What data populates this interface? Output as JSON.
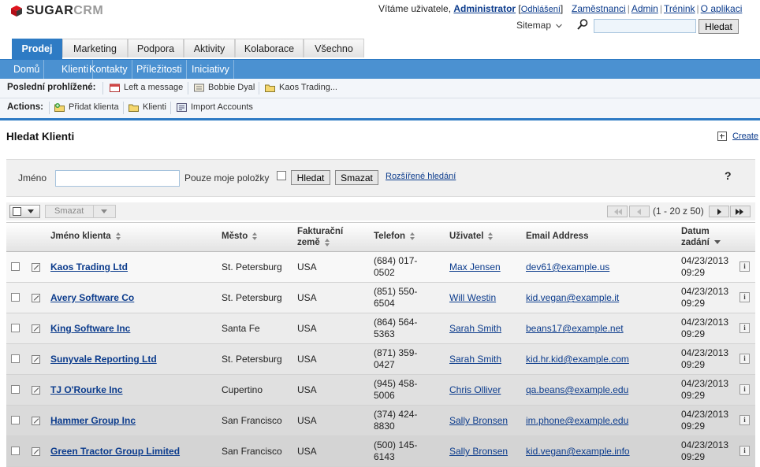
{
  "header": {
    "logo_text_dark": "SUGAR",
    "logo_text_light": "CRM",
    "welcome_prefix": "Vítáme uživatele,",
    "user_name": "Administrator",
    "bracket_open": "[",
    "logout": "Odhlášení",
    "bracket_close": "]",
    "links": [
      "Zaměstnanci",
      "Admin",
      "Trénink",
      "O aplikaci"
    ],
    "sitemap": "Sitemap",
    "search_button": "Hledat",
    "search_value": ""
  },
  "tabs": [
    {
      "label": "Prodej",
      "active": true
    },
    {
      "label": "Marketing",
      "active": false
    },
    {
      "label": "Podpora",
      "active": false
    },
    {
      "label": "Aktivity",
      "active": false
    },
    {
      "label": "Kolaborace",
      "active": false
    },
    {
      "label": "Všechno",
      "active": false
    }
  ],
  "subtabs": [
    "Domů",
    "Klienti",
    "Kontakty",
    "Příležitosti",
    "Iniciativy"
  ],
  "recent": {
    "label": "Poslední prohlížené:",
    "items": [
      {
        "label": "Left a message",
        "icon": "calendar-icon"
      },
      {
        "label": "Bobbie Dyal",
        "icon": "contact-card-icon"
      },
      {
        "label": "Kaos Trading...",
        "icon": "folder-icon"
      }
    ]
  },
  "actions": {
    "label": "Actions:",
    "items": [
      {
        "label": "Přidat klienta",
        "icon": "add-folder-icon"
      },
      {
        "label": "Klienti",
        "icon": "folder-icon"
      },
      {
        "label": "Import Accounts",
        "icon": "import-icon"
      }
    ]
  },
  "page": {
    "title": "Hledat Klienti",
    "create": "Create"
  },
  "search_form": {
    "name_label": "Jméno",
    "name_value": "",
    "only_mine_label": "Pouze moje položky",
    "only_mine_checked": false,
    "search_button": "Hledat",
    "clear_button": "Smazat",
    "advanced_link": "Rozšířené hledání",
    "help": "?"
  },
  "list_toolbar": {
    "delete_button": "Smazat",
    "pagination": "(1 - 20 z 50)"
  },
  "table": {
    "columns": [
      "Jméno klienta",
      "Město",
      "Fakturační země",
      "Telefon",
      "Uživatel",
      "Email Address",
      "Datum zadání"
    ],
    "column_lines": {
      "country": [
        "Fakturační",
        "země"
      ],
      "date": [
        "Datum",
        "zadání"
      ]
    },
    "rows": [
      {
        "name": "Kaos Trading Ltd",
        "city": "St. Petersburg",
        "country": "USA",
        "phone_1": "(684) 017-",
        "phone_2": "0502",
        "user": "Max Jensen",
        "email": "dev61@example.us",
        "date_1": "04/23/2013",
        "date_2": "09:29"
      },
      {
        "name": "Avery Software Co",
        "city": "St. Petersburg",
        "country": "USA",
        "phone_1": "(851) 550-",
        "phone_2": "6504",
        "user": "Will Westin",
        "email": "kid.vegan@example.it",
        "date_1": "04/23/2013",
        "date_2": "09:29"
      },
      {
        "name": "King Software Inc",
        "city": "Santa Fe",
        "country": "USA",
        "phone_1": "(864) 564-",
        "phone_2": "5363",
        "user": "Sarah Smith",
        "email": "beans17@example.net",
        "date_1": "04/23/2013",
        "date_2": "09:29"
      },
      {
        "name": "Sunyvale Reporting Ltd",
        "city": "St. Petersburg",
        "country": "USA",
        "phone_1": "(871) 359-",
        "phone_2": "0427",
        "user": "Sarah Smith",
        "email": "kid.hr.kid@example.com",
        "date_1": "04/23/2013",
        "date_2": "09:29"
      },
      {
        "name": "TJ O'Rourke Inc",
        "city": "Cupertino",
        "country": "USA",
        "phone_1": "(945) 458-",
        "phone_2": "5006",
        "user": "Chris Olliver",
        "email": "qa.beans@example.edu",
        "date_1": "04/23/2013",
        "date_2": "09:29"
      },
      {
        "name": "Hammer Group Inc",
        "city": "San Francisco",
        "country": "USA",
        "phone_1": "(374) 424-",
        "phone_2": "8830",
        "user": "Sally Bronsen",
        "email": "im.phone@example.edu",
        "date_1": "04/23/2013",
        "date_2": "09:29"
      },
      {
        "name": "Green Tractor Group Limited",
        "city": "San Francisco",
        "country": "USA",
        "phone_1": "(500) 145-",
        "phone_2": "6143",
        "user": "Sally Bronsen",
        "email": "kid.vegan@example.info",
        "date_1": "04/23/2013",
        "date_2": "09:29"
      }
    ]
  },
  "colors": {
    "tab_active": "#2e7bc4",
    "subbar": "#4b91d1",
    "link": "#0b3b8c"
  }
}
